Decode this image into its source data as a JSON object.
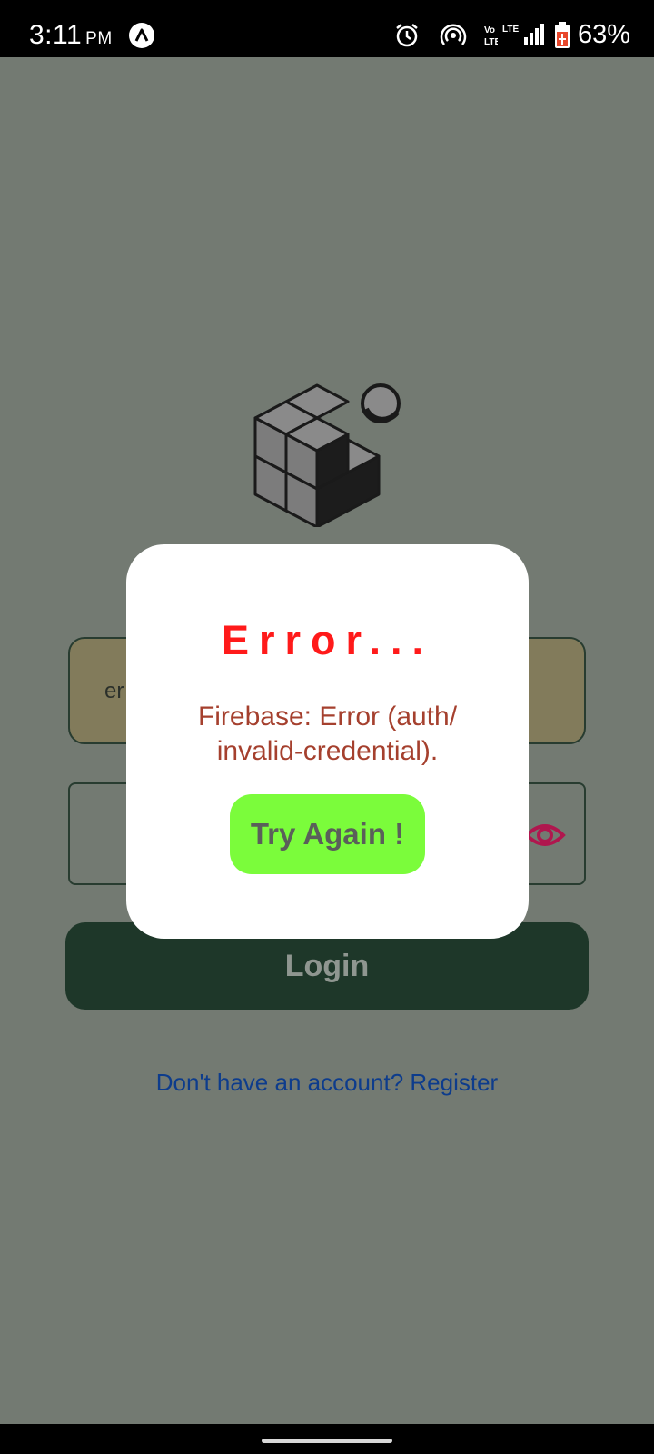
{
  "status_bar": {
    "time": "3:11",
    "ampm": "PM",
    "battery": "63%",
    "icons": [
      "app-notification-icon",
      "alarm-icon",
      "hotspot-icon",
      "volte-icon",
      "lte-signal-icon",
      "battery-icon"
    ]
  },
  "login": {
    "email_placeholder": "er",
    "login_label": "Login",
    "register_link": "Don't have an account? Register"
  },
  "dialog": {
    "title": "Error...",
    "message": "Firebase: Error (auth/ invalid-credential).",
    "button_label": "Try Again !"
  },
  "colors": {
    "backdrop": "#737a72",
    "error_title": "#ff1a1a",
    "error_message": "#a5402e",
    "try_again_bg": "#7bfc3b",
    "login_bg": "#1e3729",
    "link": "#0d3c8c",
    "eye_icon": "#b0164e"
  }
}
